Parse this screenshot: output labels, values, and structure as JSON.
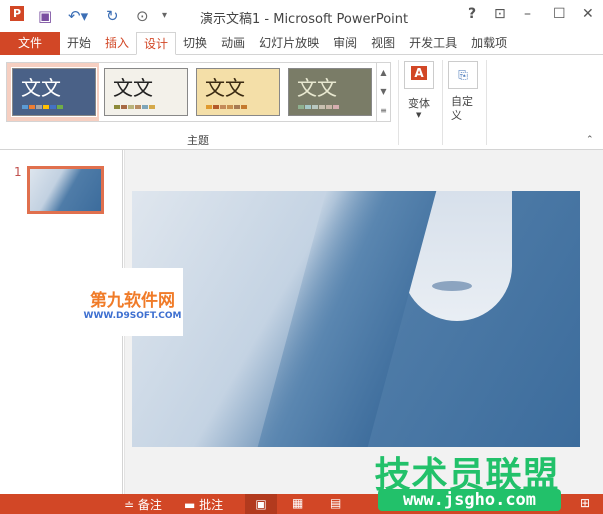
{
  "window": {
    "title": "演示文稿1 - Microsoft PowerPoint",
    "help": "?"
  },
  "tabs": [
    "文件",
    "开始",
    "插入",
    "设计",
    "切换",
    "动画",
    "幻灯片放映",
    "审阅",
    "视图",
    "开发工具",
    "加载项"
  ],
  "ribbon": {
    "themes": [
      {
        "text": "文文",
        "bg": "#4a6187",
        "fg": "#ffffff",
        "swatches": [
          "#5b9bd5",
          "#ed7d31",
          "#a5a5a5",
          "#ffc000",
          "#4472c4",
          "#70ad47"
        ]
      },
      {
        "text": "文文",
        "bg": "#f3f1ea",
        "fg": "#222222",
        "swatches": [
          "#8d8a3a",
          "#a86a45",
          "#b9b37b",
          "#b78c62",
          "#7fa6b9",
          "#d4a94a"
        ]
      },
      {
        "text": "文文",
        "bg": "#f4dfa8",
        "fg": "#3a2a12",
        "swatches": [
          "#e09a2e",
          "#b35a2a",
          "#c48b5a",
          "#c88f4e",
          "#a67a52",
          "#c57a2e"
        ]
      },
      {
        "text": "文文",
        "bg": "#7a7c67",
        "fg": "#e8e8d0",
        "swatches": [
          "#8fb08f",
          "#a5c8c8",
          "#b8c7c0",
          "#c8c0b0",
          "#c9b7a8",
          "#d6aeb0"
        ]
      }
    ],
    "group_label": "主题",
    "variants": "变体",
    "customize": "自定义"
  },
  "slides": {
    "number": "1"
  },
  "watermarks": {
    "d9_cn": "第九软件网",
    "d9_url": "WWW.D9SOFT.COM",
    "js_cn": "技术员联盟",
    "js_url": "www.jsgho.com"
  },
  "status": {
    "notes": "备注",
    "comments": "批注"
  },
  "colors": {
    "accent": "#d24726",
    "watermark_green": "#22c16a"
  }
}
